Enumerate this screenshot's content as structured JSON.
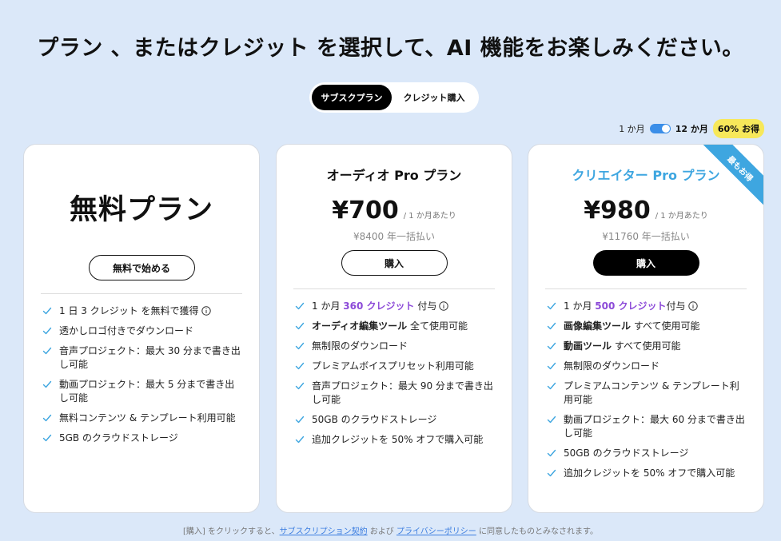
{
  "headline": "プラン 、またはクレジット を選択して、AI 機能をお楽しみください。",
  "tabs": [
    {
      "label": "サブスクプラン",
      "active": true
    },
    {
      "label": "クレジット購入",
      "active": false
    }
  ],
  "billing": {
    "monthly_label": "1 か月",
    "yearly_label": "12 か月",
    "yearly_selected": true,
    "discount_badge": "60% お得"
  },
  "plans": {
    "free": {
      "title": "無料プラン",
      "button": "無料で始める",
      "features": {
        "f1_text": "1 日 3 クレジット を無料で獲得",
        "f2": "透かしロゴ付きでダウンロード",
        "f3": "音声プロジェクト：最大 30 分まで書き出し可能",
        "f4": "動画プロジェクト：最大 5 分まで書き出し可能",
        "f5": "無料コンテンツ & テンプレート利用可能",
        "f6": "5GB のクラウドストレージ"
      }
    },
    "audio": {
      "name": "オーディオ Pro プラン",
      "price": "¥700",
      "per": "/ 1 か月あたり",
      "annual": "¥8400 年一括払い",
      "button": "購入",
      "features": {
        "f1_pre": "1 か月 ",
        "f1_credits": "360 クレジット",
        "f1_post": " 付与",
        "f2_bold": "オーディオ編集ツール",
        "f2_rest": " 全て使用可能",
        "f3": "無制限のダウンロード",
        "f4": "プレミアムボイスプリセット利用可能",
        "f5": "音声プロジェクト：最大 90 分まで書き出し可能",
        "f6": "50GB のクラウドストレージ",
        "f7": "追加クレジットを 50% オフで購入可能"
      }
    },
    "creator": {
      "name": "クリエイター Pro プラン",
      "ribbon": "最もお得",
      "price": "¥980",
      "per": "/ 1 か月あたり",
      "annual": "¥11760 年一括払い",
      "button": "購入",
      "accent_color": "#3ea6e0",
      "features": {
        "f1_pre": "1 か月 ",
        "f1_credits": "500 クレジット",
        "f1_post": "付与",
        "f2_bold": "画像編集ツール",
        "f2_rest": " すべて使用可能",
        "f3_bold": "動画ツール",
        "f3_rest": " すべて使用可能",
        "f4": "無制限のダウンロード",
        "f5": "プレミアムコンテンツ & テンプレート利用可能",
        "f6": "動画プロジェクト：最大 60 分まで書き出し可能",
        "f7": "50GB のクラウドストレージ",
        "f8": "追加クレジットを 50% オフで購入可能"
      }
    }
  },
  "footer": {
    "pre": "[購入] をクリックすると、",
    "link1": "サブスクリプション契約",
    "mid": " および ",
    "link2": "プライバシーポリシー",
    "post": " に同意したものとみなされます。"
  }
}
